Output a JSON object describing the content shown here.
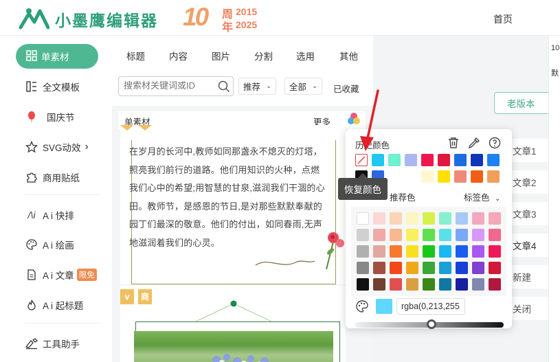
{
  "header": {
    "logo_text": "小墨鹰编辑器",
    "anniversary": {
      "number": "10",
      "zhou": "周",
      "nian": "年",
      "year_start": "2015",
      "year_end": "2025"
    },
    "nav_home": "首页"
  },
  "sidebar": {
    "active": "单素材",
    "items": [
      "全文模板",
      "国庆节",
      "SVG动效",
      "商用贴纸",
      "A i 快排",
      "A i 绘画",
      "A i 文章",
      "A i 起标题",
      "工具助手"
    ],
    "limit_badge": "限免",
    "svg_arrow": "›"
  },
  "panel": {
    "tabs": [
      "标题",
      "内容",
      "图片",
      "分割",
      "选用",
      "其他"
    ],
    "search_placeholder": "搜索材关键词或ID",
    "sort_select": "推荐",
    "range_select": "全部",
    "favorites": "已收藏",
    "list_title": "单素材",
    "more": "更多",
    "card_text": "在岁月的长河中,教师如同那盏永不熄灭的灯塔，照亮我们前行的道路。他们用知识的火种，点燃我们心中的希望;用智慧的甘泉,滋润我们干涸的心田。教师节，是感恩的节日,是对那些默默奉献的园丁们最深的敬意。他们的付出，如同春雨,无声地滋润着我们的心灵。",
    "card2_badge_v": "v",
    "card2_badge_shang": "商"
  },
  "right": {
    "old_version": "老版本",
    "articles": [
      "文章1",
      "文章2",
      "文章3",
      "文章4",
      "新建",
      "关闭"
    ],
    "edge_text_1": "10",
    "edge_text_2": "默"
  },
  "color_picker": {
    "history_label": "历史颜色",
    "recommended_label": "推荐色",
    "tag_color_label": "标签色",
    "tooltip": "恢复颜色",
    "rgba_value": "rgba(0,213,255",
    "history_colors": [
      "#ffffff",
      "#1ec8f0",
      "#6ff0d0",
      "#a9b8ee",
      "#f0174f",
      "#e0173f",
      "#1b6ce0",
      "#1036b8",
      "#1e82f0"
    ],
    "history_colors_2": [
      "#111111",
      "#2a67e0",
      "#ffffff",
      "#ffffff",
      "#fff7d0",
      "#ffe000",
      "#f08a78",
      "#f05f18",
      "#f0a05a"
    ],
    "palette": [
      [
        "#ffffff",
        "#fbd7d7",
        "#fbd5b5",
        "#fcf6c0",
        "#d8f04c",
        "#86f0d0",
        "#a8c8f8",
        "#f4a8c0",
        "#f4a8b8"
      ],
      [
        "#d0d0d0",
        "#f0a8a8",
        "#f8b890",
        "#f8f060",
        "#5ee050",
        "#5ae0e8",
        "#7aa8f8",
        "#d898f8",
        "#f06890"
      ],
      [
        "#b0b0b0",
        "#e0a8a0",
        "#f87830",
        "#f8e020",
        "#18c818",
        "#18b8f0",
        "#1a5ef0",
        "#a858f0",
        "#f01858"
      ],
      [
        "#888888",
        "#a05040",
        "#f04818",
        "#f0a818",
        "#38a838",
        "#18a0d8",
        "#1840d8",
        "#8040d0",
        "#d01838"
      ],
      [
        "#111111",
        "#704030",
        "#e05050",
        "#d8a040",
        "#3a8818",
        "#1078a0",
        "#1820a0",
        "#8088b0",
        "#b01840"
      ]
    ],
    "current_color": "#5fd7ff"
  }
}
